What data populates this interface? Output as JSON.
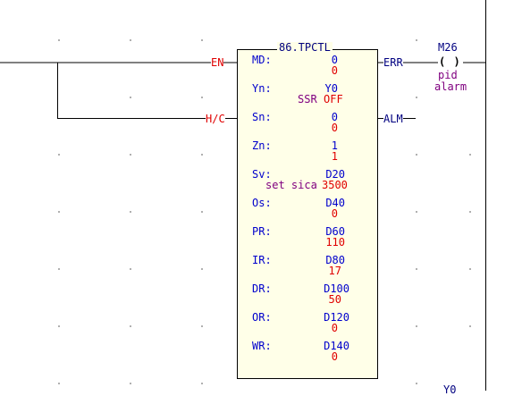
{
  "block": {
    "title": "86.TPCTL",
    "inputs": [
      "EN",
      "H/C"
    ],
    "outputs": [
      "ERR",
      "ALM"
    ],
    "params": [
      {
        "name": "MD:",
        "device": "0",
        "value": "0",
        "comment": ""
      },
      {
        "name": "Yn:",
        "device": "Y0",
        "value": "OFF",
        "comment": "SSR"
      },
      {
        "name": "Sn:",
        "device": "0",
        "value": "0",
        "comment": ""
      },
      {
        "name": "Zn:",
        "device": "1",
        "value": "1",
        "comment": ""
      },
      {
        "name": "Sv:",
        "device": "D20",
        "value": "3500",
        "comment": "set sica"
      },
      {
        "name": "Os:",
        "device": "D40",
        "value": "0",
        "comment": ""
      },
      {
        "name": "PR:",
        "device": "D60",
        "value": "110",
        "comment": ""
      },
      {
        "name": "IR:",
        "device": "D80",
        "value": "17",
        "comment": ""
      },
      {
        "name": "DR:",
        "device": "D100",
        "value": "50",
        "comment": ""
      },
      {
        "name": "OR:",
        "device": "D120",
        "value": "0",
        "comment": ""
      },
      {
        "name": "WR:",
        "device": "D140",
        "value": "0",
        "comment": ""
      }
    ]
  },
  "coil": {
    "device": "M26",
    "symbol": "( )",
    "comment_line1": "pid",
    "comment_line2": "alarm"
  },
  "bottom_label": "Y0",
  "colors": {
    "wire": "#000000",
    "io_label": "#e00000",
    "param_name": "#0000cc",
    "device": "#0000cc",
    "value": "#e00000",
    "comment": "#800080",
    "block_bg": "#ffffe8"
  }
}
